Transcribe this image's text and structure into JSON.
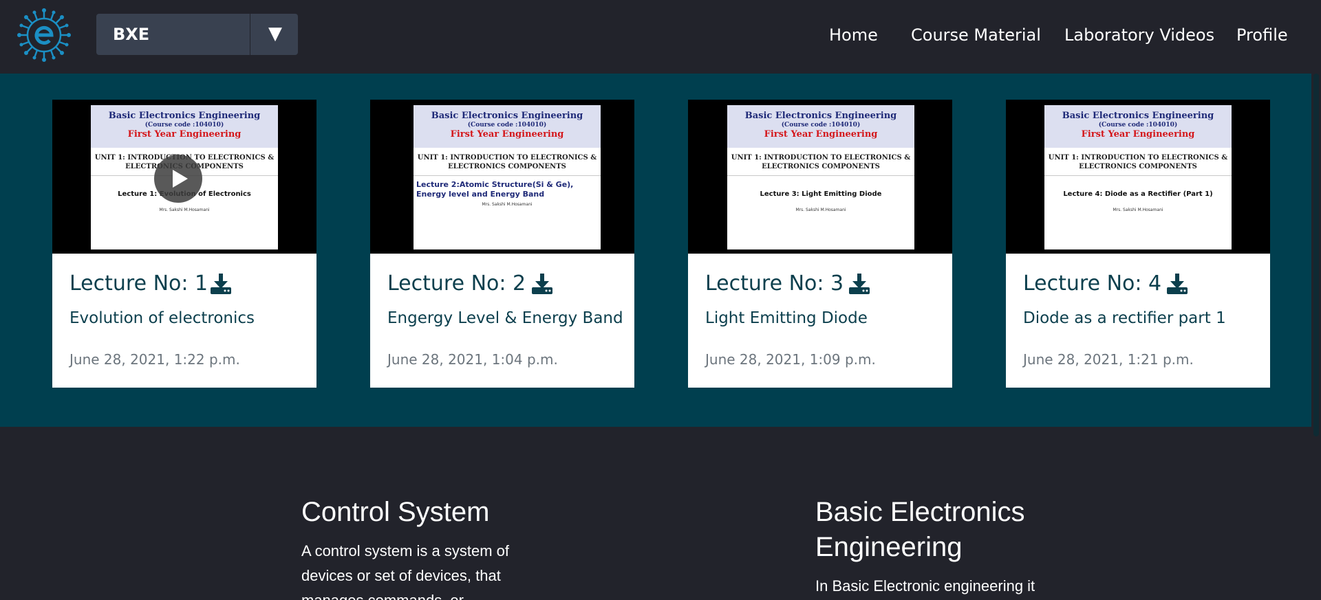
{
  "nav": {
    "course_selected": "BXE",
    "links": [
      "Home",
      "Course Material",
      "Laboratory Videos",
      "Profile"
    ]
  },
  "lectures": [
    {
      "title": "Lecture No: 1",
      "subtitle": "Evolution of electronics",
      "date": "June 28, 2021, 1:22 p.m.",
      "slide": {
        "course": "Basic Electronics Engineering",
        "code": "(Course code :104010)",
        "year": "First Year Engineering",
        "unit": "UNIT 1: INTRODUCTION TO ELECTRONICS & ELECTRONICS COMPONENTS",
        "lecture": "Lecture 1: Evolution of Electronics",
        "author": "Mrs. Sakshi M.Hosamani"
      }
    },
    {
      "title": "Lecture No: 2",
      "subtitle": "Engergy Level & Energy Band",
      "date": "June 28, 2021, 1:04 p.m.",
      "slide": {
        "course": "Basic Electronics Engineering",
        "code": "(Course code :104010)",
        "year": "First Year Engineering",
        "unit": "UNIT 1: INTRODUCTION TO ELECTRONICS & ELECTRONICS COMPONENTS",
        "lecture": "Lecture 2:Atomic Structure(Si & Ge), Energy level and Energy Band",
        "author": "Mrs. Sakshi M.Hosamani"
      }
    },
    {
      "title": "Lecture No: 3",
      "subtitle": "Light Emitting Diode",
      "date": "June 28, 2021, 1:09 p.m.",
      "slide": {
        "course": "Basic Electronics Engineering",
        "code": "(Course code :104010)",
        "year": "First Year Engineering",
        "unit": "UNIT 1: INTRODUCTION TO ELECTRONICS & ELECTRONICS COMPONENTS",
        "lecture": "Lecture 3: Light Emitting Diode",
        "author": "Mrs. Sakshi M.Hosamani"
      }
    },
    {
      "title": "Lecture No: 4",
      "subtitle": "Diode as a rectifier part 1",
      "date": "June 28, 2021, 1:21 p.m.",
      "slide": {
        "course": "Basic Electronics Engineering",
        "code": "(Course code :104010)",
        "year": "First Year Engineering",
        "unit": "UNIT 1: INTRODUCTION TO ELECTRONICS & ELECTRONICS COMPONENTS",
        "lecture": "Lecture 4: Diode as a Rectifier (Part 1)",
        "author": "Mrs. Sakshi M.Hosamani"
      }
    }
  ],
  "info": {
    "control": {
      "title": "Control System",
      "text_lines": [
        "A control system is a system of",
        "devices or set of devices, that",
        "manages commands, or"
      ]
    },
    "bxe": {
      "title_lines": [
        "Basic Electronics",
        "Engineering"
      ],
      "text_lines": [
        "In Basic Electronic engineering it"
      ]
    }
  },
  "colors": {
    "background": "#22232b",
    "band": "#003f4f",
    "select": "#394150",
    "accent_text": "#0c3f4d",
    "date_text": "#6c757d",
    "logo": "#1b8fc4"
  },
  "icons": [
    "logo-icon",
    "chevron-down-icon",
    "play-icon",
    "download-icon"
  ]
}
